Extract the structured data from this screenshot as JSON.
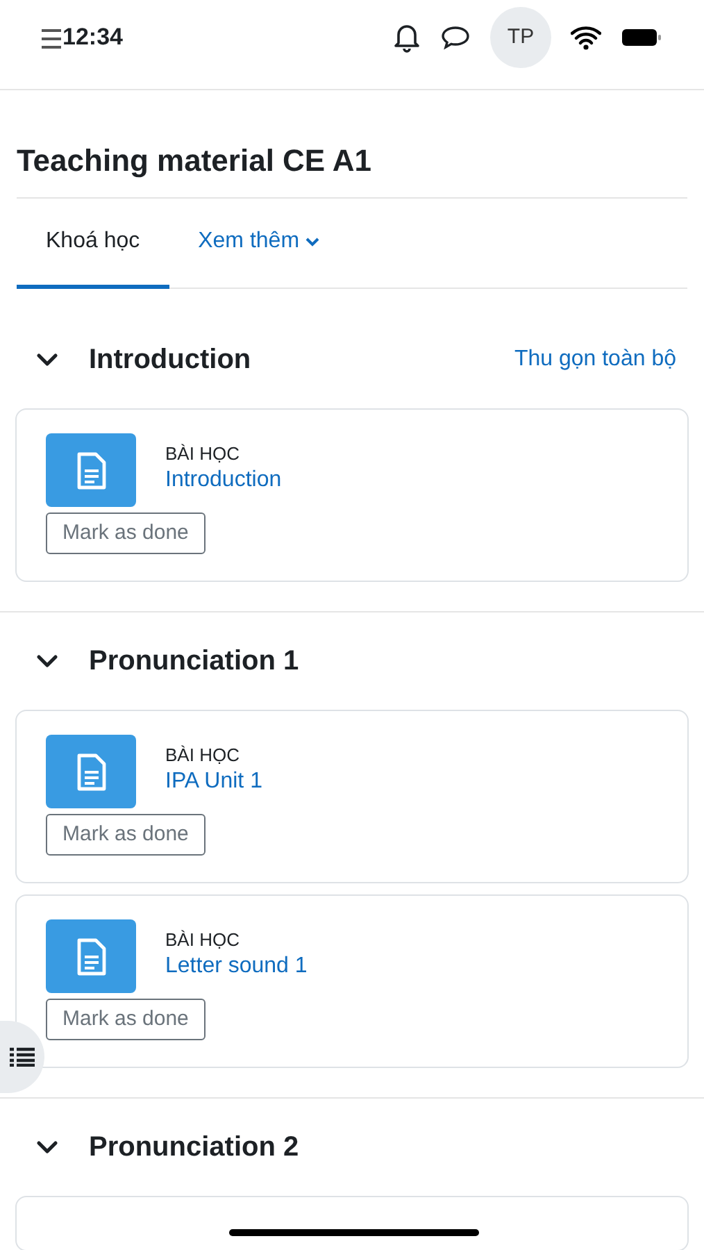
{
  "status_bar": {
    "time": "12:34"
  },
  "header": {
    "avatar": "TP"
  },
  "title": "Teaching material CE A1",
  "tabs": [
    {
      "label": "Khoá học",
      "selected": true,
      "dropdown": false
    },
    {
      "label": "Xem thêm",
      "selected": false,
      "dropdown": true
    }
  ],
  "collapse_all": "Thu gọn toàn bộ",
  "sections": [
    {
      "title": "Introduction",
      "expanded": true,
      "activities": [
        {
          "kind": "lesson",
          "type_label": "BÀI HỌC",
          "name": "Introduction",
          "button": "Mark as done"
        }
      ]
    },
    {
      "title": "Pronunciation 1",
      "expanded": true,
      "activities": [
        {
          "kind": "lesson",
          "type_label": "BÀI HỌC",
          "name": "IPA Unit 1",
          "button": "Mark as done"
        },
        {
          "kind": "lesson",
          "type_label": "BÀI HỌC",
          "name": "Letter sound 1",
          "button": "Mark as done"
        }
      ]
    },
    {
      "title": "Pronunciation 2",
      "expanded": true
    }
  ]
}
